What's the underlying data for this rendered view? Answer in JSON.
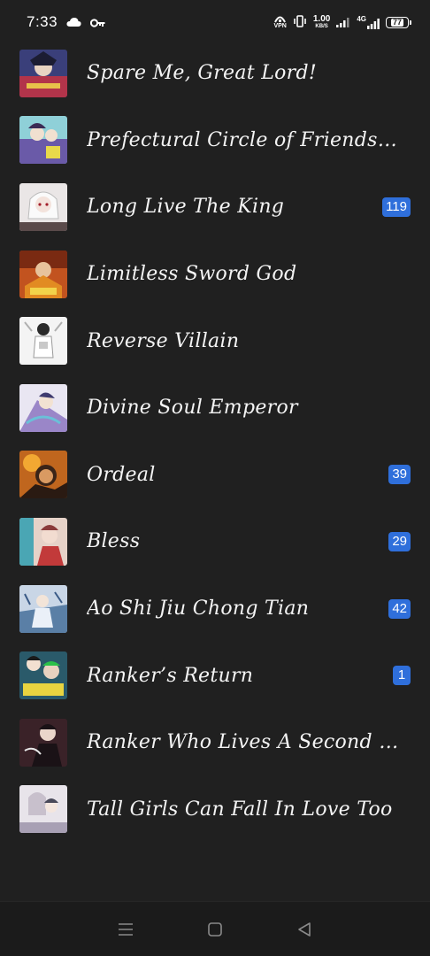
{
  "status_bar": {
    "time": "7:33",
    "vpn_label": "VPN",
    "speed_value": "1.00",
    "speed_unit": "KB/S",
    "network": "4G",
    "battery": "77",
    "icons": [
      "cloud-icon",
      "key-icon",
      "vpn-icon",
      "vibrate-icon",
      "signal-icon",
      "signal-4g-icon",
      "battery-icon"
    ]
  },
  "library": {
    "items": [
      {
        "title": "Spare Me, Great Lord!",
        "badge": "",
        "cover_color": "#3a3f7a"
      },
      {
        "title": "Prefectural Circle of Friends (R...",
        "badge": "",
        "cover_color": "#6a5aa8"
      },
      {
        "title": "Long Live The King",
        "badge": "119",
        "cover_color": "#d8d4d4"
      },
      {
        "title": "Limitless Sword God",
        "badge": "",
        "cover_color": "#c2531f"
      },
      {
        "title": "Reverse Villain",
        "badge": "",
        "cover_color": "#eeeeee"
      },
      {
        "title": "Divine Soul Emperor",
        "badge": "",
        "cover_color": "#9a86c8"
      },
      {
        "title": "Ordeal",
        "badge": "39",
        "cover_color": "#c0661e"
      },
      {
        "title": "Bless",
        "badge": "29",
        "cover_color": "#4aa6b4"
      },
      {
        "title": "Ao Shi Jiu Chong Tian",
        "badge": "42",
        "cover_color": "#5a7fa6"
      },
      {
        "title": "Ranker’s Return",
        "badge": "1",
        "cover_color": "#2a5a6a"
      },
      {
        "title": "Ranker Who Lives A Second Ti...",
        "badge": "",
        "cover_color": "#3a2228"
      },
      {
        "title": "Tall Girls Can Fall In Love Too",
        "badge": "",
        "cover_color": "#c8c0cc"
      }
    ]
  },
  "nav_bar": {
    "icons": [
      "menu-icon",
      "home-icon",
      "back-icon"
    ]
  }
}
